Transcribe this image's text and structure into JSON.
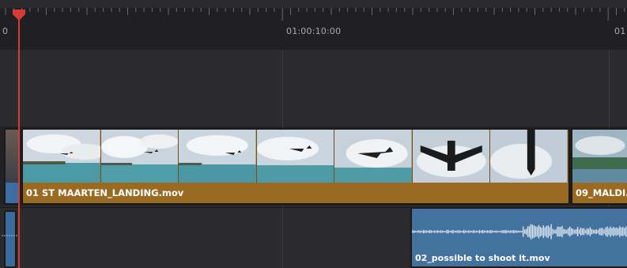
{
  "ruler": {
    "timecode_left": "0",
    "timecode_mid": "01:00:10:00",
    "timecode_right": "01"
  },
  "colors": {
    "video_clip": "#9b6a22",
    "audio_clip": "#44729f",
    "playhead": "#d83a3a",
    "background": "#2b2b2d"
  },
  "clips": {
    "video_main_label": "01 ST MAARTEN_LANDING.mov",
    "video_right_label": "09_MALDI...",
    "audio_label": "02_possible to shoot it.mov"
  }
}
